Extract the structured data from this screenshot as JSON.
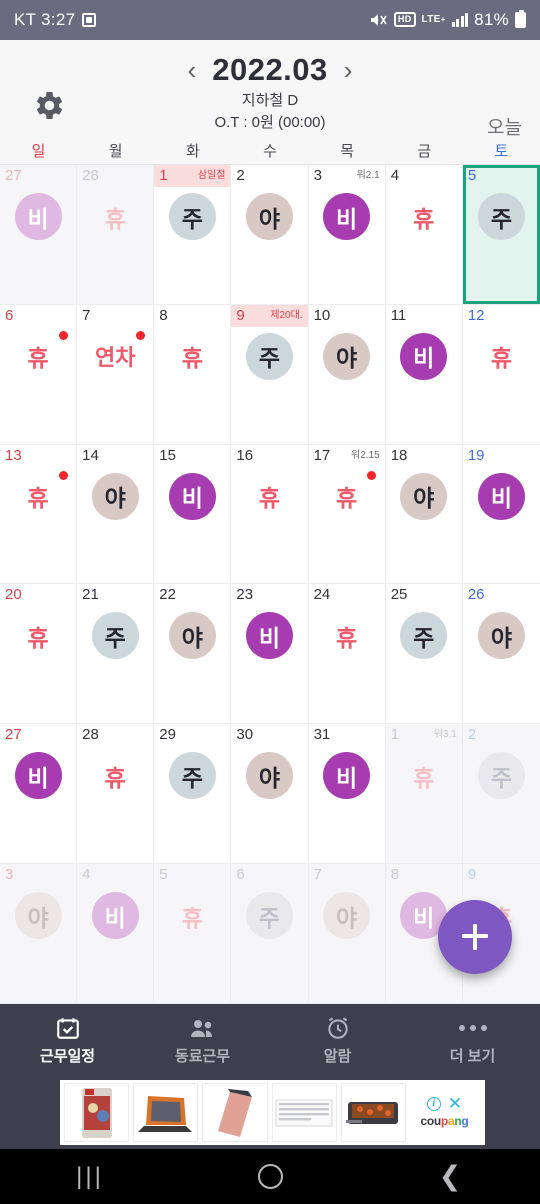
{
  "statusbar": {
    "carrier_time": "KT 3:27",
    "alarm_icon": "alarm-set-icon",
    "mute_icon": "mute-icon",
    "hd_label": "HD",
    "network_label": "LTE",
    "network_sup": "+",
    "battery_percent": "81%"
  },
  "header": {
    "gear_icon": "gear-icon",
    "prev_label": "‹",
    "next_label": "›",
    "month_title": "2022.03",
    "subtitle": "지하철 D",
    "overtime": "O.T : 0원 (00:00)",
    "today_label": "오늘"
  },
  "weekdays": [
    {
      "label": "일",
      "kind": "sun"
    },
    {
      "label": "월",
      "kind": "wk"
    },
    {
      "label": "화",
      "kind": "wk"
    },
    {
      "label": "수",
      "kind": "wk"
    },
    {
      "label": "목",
      "kind": "wk"
    },
    {
      "label": "금",
      "kind": "wk"
    },
    {
      "label": "토",
      "kind": "sat"
    }
  ],
  "colors": {
    "accent_purple": "#7E57C2",
    "badge_day": "#CCD7DC",
    "badge_night": "#D8C9C4",
    "badge_off_duty": "#A73CB0",
    "rest_text": "#EF5A6A",
    "selected_border": "#1BA37E",
    "selected_bg": "#E1F5EE",
    "holiday_bg": "#F9DCDC",
    "marker_dot": "#F2262C",
    "navbar_bg": "#3E3E4C",
    "statusbar_bg": "#6B6B80"
  },
  "selected_day": "5",
  "days": [
    {
      "num": "27",
      "col": "sun",
      "out": true,
      "badge": "비",
      "type": "bi",
      "label": "",
      "holiday": false,
      "dot": false
    },
    {
      "num": "28",
      "col": "wk",
      "out": true,
      "badge": "휴",
      "type": "hyu",
      "label": "",
      "holiday": false,
      "dot": false
    },
    {
      "num": "1",
      "col": "wk",
      "out": false,
      "badge": "주",
      "type": "ju",
      "label": "삼일절",
      "holiday": true,
      "dot": false
    },
    {
      "num": "2",
      "col": "wk",
      "out": false,
      "badge": "야",
      "type": "ya",
      "label": "",
      "holiday": false,
      "dot": false
    },
    {
      "num": "3",
      "col": "wk",
      "out": false,
      "badge": "비",
      "type": "bi",
      "label": "워2.1",
      "holiday": false,
      "dot": false
    },
    {
      "num": "4",
      "col": "wk",
      "out": false,
      "badge": "휴",
      "type": "hyu",
      "label": "",
      "holiday": false,
      "dot": false
    },
    {
      "num": "5",
      "col": "sat",
      "out": false,
      "badge": "주",
      "type": "ju",
      "label": "",
      "holiday": false,
      "dot": false,
      "selected": true
    },
    {
      "num": "6",
      "col": "sun",
      "out": false,
      "badge": "휴",
      "type": "hyu",
      "label": "",
      "holiday": false,
      "dot": true
    },
    {
      "num": "7",
      "col": "wk",
      "out": false,
      "badge": "연차",
      "type": "yeoncha",
      "label": "",
      "holiday": false,
      "dot": true
    },
    {
      "num": "8",
      "col": "wk",
      "out": false,
      "badge": "휴",
      "type": "hyu",
      "label": "",
      "holiday": false,
      "dot": false
    },
    {
      "num": "9",
      "col": "wk",
      "out": false,
      "badge": "주",
      "type": "ju",
      "label": "제20대.",
      "holiday": true,
      "dot": false
    },
    {
      "num": "10",
      "col": "wk",
      "out": false,
      "badge": "야",
      "type": "ya",
      "label": "",
      "holiday": false,
      "dot": false
    },
    {
      "num": "11",
      "col": "wk",
      "out": false,
      "badge": "비",
      "type": "bi",
      "label": "",
      "holiday": false,
      "dot": false
    },
    {
      "num": "12",
      "col": "sat",
      "out": false,
      "badge": "휴",
      "type": "hyu",
      "label": "",
      "holiday": false,
      "dot": false
    },
    {
      "num": "13",
      "col": "sun",
      "out": false,
      "badge": "휴",
      "type": "hyu",
      "label": "",
      "holiday": false,
      "dot": true
    },
    {
      "num": "14",
      "col": "wk",
      "out": false,
      "badge": "야",
      "type": "ya",
      "label": "",
      "holiday": false,
      "dot": false
    },
    {
      "num": "15",
      "col": "wk",
      "out": false,
      "badge": "비",
      "type": "bi",
      "label": "",
      "holiday": false,
      "dot": false
    },
    {
      "num": "16",
      "col": "wk",
      "out": false,
      "badge": "휴",
      "type": "hyu",
      "label": "",
      "holiday": false,
      "dot": false
    },
    {
      "num": "17",
      "col": "wk",
      "out": false,
      "badge": "휴",
      "type": "hyu",
      "label": "워2.15",
      "holiday": false,
      "dot": true
    },
    {
      "num": "18",
      "col": "wk",
      "out": false,
      "badge": "야",
      "type": "ya",
      "label": "",
      "holiday": false,
      "dot": false
    },
    {
      "num": "19",
      "col": "sat",
      "out": false,
      "badge": "비",
      "type": "bi",
      "label": "",
      "holiday": false,
      "dot": false
    },
    {
      "num": "20",
      "col": "sun",
      "out": false,
      "badge": "휴",
      "type": "hyu",
      "label": "",
      "holiday": false,
      "dot": false
    },
    {
      "num": "21",
      "col": "wk",
      "out": false,
      "badge": "주",
      "type": "ju",
      "label": "",
      "holiday": false,
      "dot": false
    },
    {
      "num": "22",
      "col": "wk",
      "out": false,
      "badge": "야",
      "type": "ya",
      "label": "",
      "holiday": false,
      "dot": false
    },
    {
      "num": "23",
      "col": "wk",
      "out": false,
      "badge": "비",
      "type": "bi",
      "label": "",
      "holiday": false,
      "dot": false
    },
    {
      "num": "24",
      "col": "wk",
      "out": false,
      "badge": "휴",
      "type": "hyu",
      "label": "",
      "holiday": false,
      "dot": false
    },
    {
      "num": "25",
      "col": "wk",
      "out": false,
      "badge": "주",
      "type": "ju",
      "label": "",
      "holiday": false,
      "dot": false
    },
    {
      "num": "26",
      "col": "sat",
      "out": false,
      "badge": "야",
      "type": "ya",
      "label": "",
      "holiday": false,
      "dot": false
    },
    {
      "num": "27",
      "col": "sun",
      "out": false,
      "badge": "비",
      "type": "bi",
      "label": "",
      "holiday": false,
      "dot": false
    },
    {
      "num": "28",
      "col": "wk",
      "out": false,
      "badge": "휴",
      "type": "hyu",
      "label": "",
      "holiday": false,
      "dot": false
    },
    {
      "num": "29",
      "col": "wk",
      "out": false,
      "badge": "주",
      "type": "ju",
      "label": "",
      "holiday": false,
      "dot": false
    },
    {
      "num": "30",
      "col": "wk",
      "out": false,
      "badge": "야",
      "type": "ya",
      "label": "",
      "holiday": false,
      "dot": false
    },
    {
      "num": "31",
      "col": "wk",
      "out": false,
      "badge": "비",
      "type": "bi",
      "label": "",
      "holiday": false,
      "dot": false
    },
    {
      "num": "1",
      "col": "wk",
      "out": true,
      "badge": "휴",
      "type": "hyu",
      "label": "워3.1",
      "holiday": false,
      "dot": false
    },
    {
      "num": "2",
      "col": "sat",
      "out": true,
      "badge": "주",
      "type": "ju",
      "label": "",
      "holiday": false,
      "dot": false
    },
    {
      "num": "3",
      "col": "sun",
      "out": true,
      "badge": "야",
      "type": "ya",
      "label": "",
      "holiday": false,
      "dot": false
    },
    {
      "num": "4",
      "col": "wk",
      "out": true,
      "badge": "비",
      "type": "bi",
      "label": "",
      "holiday": false,
      "dot": false
    },
    {
      "num": "5",
      "col": "wk",
      "out": true,
      "badge": "휴",
      "type": "hyu",
      "label": "",
      "holiday": false,
      "dot": false
    },
    {
      "num": "6",
      "col": "wk",
      "out": true,
      "badge": "주",
      "type": "ju",
      "label": "",
      "holiday": false,
      "dot": false
    },
    {
      "num": "7",
      "col": "wk",
      "out": true,
      "badge": "야",
      "type": "ya",
      "label": "",
      "holiday": false,
      "dot": false
    },
    {
      "num": "8",
      "col": "wk",
      "out": true,
      "badge": "비",
      "type": "bi",
      "label": "",
      "holiday": false,
      "dot": false
    },
    {
      "num": "9",
      "col": "sat",
      "out": true,
      "badge": "휴",
      "type": "hyu",
      "label": "",
      "holiday": false,
      "dot": false
    }
  ],
  "fab": {
    "icon": "plus-icon",
    "label": "+"
  },
  "bottomnav": [
    {
      "label": "근무일정",
      "icon": "calendar-check-icon",
      "active": true
    },
    {
      "label": "동료근무",
      "icon": "people-icon",
      "active": false
    },
    {
      "label": "알람",
      "icon": "alarm-clock-icon",
      "active": false
    },
    {
      "label": "더 보기",
      "icon": "more-dots-icon",
      "active": false
    }
  ],
  "ad": {
    "brand": "coupang",
    "info_icon": "info-icon",
    "close_icon": "close-icon",
    "products": [
      "game-cartridge",
      "laptop",
      "external-drive",
      "keyboard",
      "grill"
    ]
  },
  "sysnav": {
    "recent_icon": "recents-icon",
    "home_icon": "home-icon",
    "back_icon": "back-icon"
  }
}
